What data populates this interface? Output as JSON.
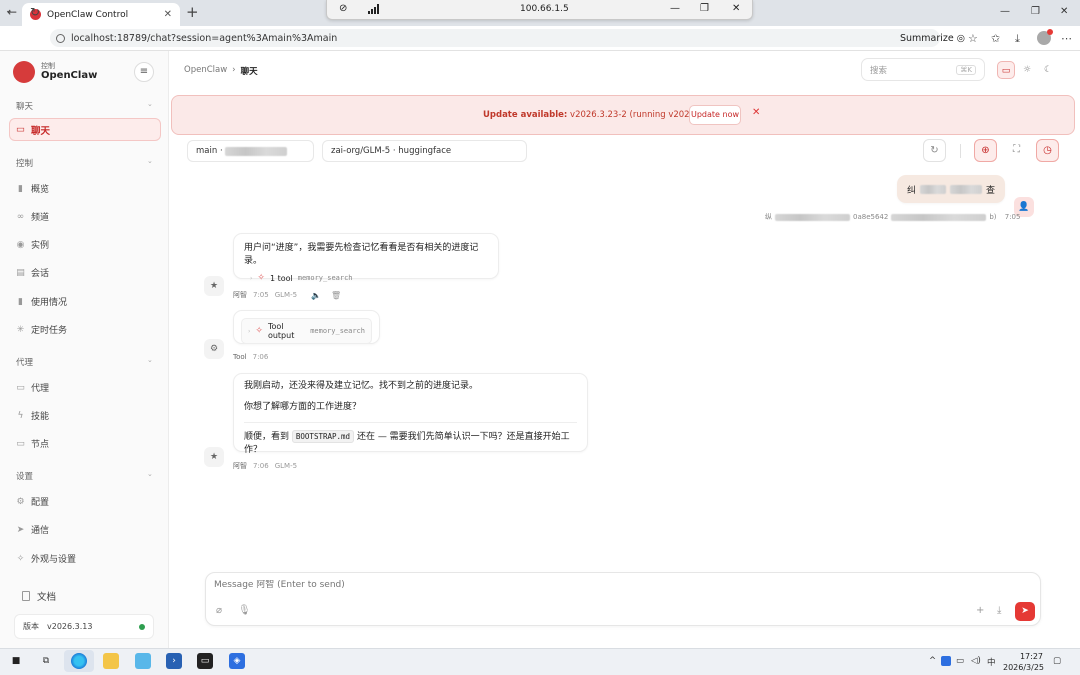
{
  "browser": {
    "tab_title": "OpenClaw Control",
    "rdp_ip": "100.66.1.5",
    "url": "localhost:18789/chat?session=agent%3Amain%3Amain",
    "summarize_label": "Summarize"
  },
  "sidebar": {
    "brand_sub": "控制",
    "brand_title": "OpenClaw",
    "sections": {
      "chat": "聊天",
      "control": "控制",
      "agent": "代理",
      "settings": "设置"
    },
    "items": {
      "chat": "聊天",
      "overview": "概览",
      "channels": "频道",
      "instances": "实例",
      "sessions": "会话",
      "usage": "使用情况",
      "cron": "定时任务",
      "agents": "代理",
      "skills": "技能",
      "nodes": "节点",
      "config": "配置",
      "comms": "通信",
      "appearance": "外观与设置"
    },
    "docs_label": "文档",
    "version_label": "版本",
    "version_value": "v2026.3.13"
  },
  "header": {
    "breadcrumb_root": "OpenClaw",
    "breadcrumb_current": "聊天",
    "search_placeholder": "搜索",
    "search_shortcut": "⌘K"
  },
  "banner": {
    "prefix": "Update available:",
    "text": "v2026.3.23-2 (running v2026.3.13).",
    "button": "Update now"
  },
  "session": {
    "agent_prefix": "main ·",
    "model": "zai-org/GLM-5 · huggingface"
  },
  "messages": {
    "user_first": "纠",
    "user_last": "查",
    "user_meta_prefix": "纵",
    "user_meta_mid": "0a8e5642",
    "user_meta_suffix": "b)",
    "user_time": "7:05",
    "assistant1_text": "用户问“进度”，我需要先检查记忆看看是否有相关的进度记录。",
    "assistant1_tool_count": "1 tool",
    "assistant1_tool_name": "memory_search",
    "assistant1_sender": "阿智",
    "assistant1_time": "7:05",
    "assistant1_model": "GLM-5",
    "tool_output_label": "Tool output",
    "tool_output_name": "memory_search",
    "tool_sender": "Tool",
    "tool_time": "7:06",
    "assistant2_line1": "我刚启动，还没来得及建立记忆。找不到之前的进度记录。",
    "assistant2_line2": "你想了解哪方面的工作进度？",
    "assistant2_line3_a": "顺便，看到",
    "assistant2_code": "BOOTSTRAP.md",
    "assistant2_line3_b": "还在 — 需要我们先简单认识一下吗？还是直接开始工作？",
    "assistant2_sender": "阿智",
    "assistant2_time": "7:06",
    "assistant2_model": "GLM-5"
  },
  "composer": {
    "placeholder": "Message 阿智 (Enter to send)"
  },
  "taskbar": {
    "ime": "中",
    "time": "17:27",
    "date": "2026/3/25"
  }
}
